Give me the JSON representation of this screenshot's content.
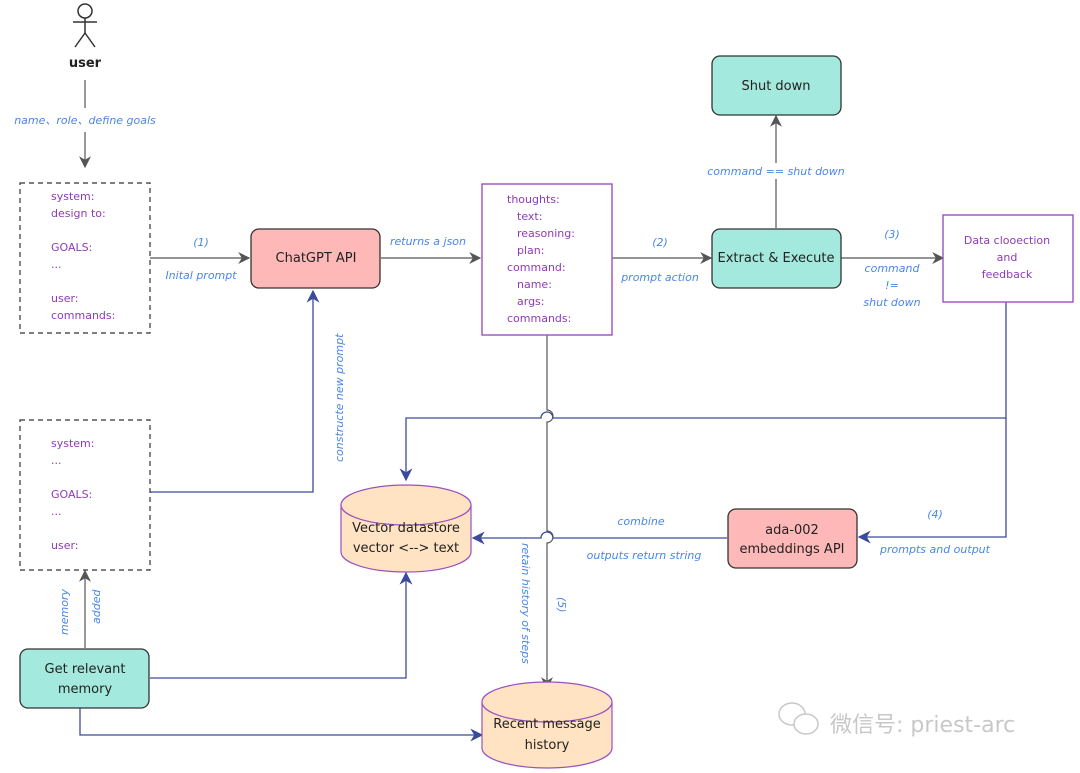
{
  "colors": {
    "teal_node": "#a3e9dd",
    "pink_node": "#ffb8b8",
    "db_fill": "#ffe3c2",
    "db_stroke": "#9b4fc0",
    "purple_box": "#9b4fc0",
    "purple_text": "#8e3bb8",
    "label_blue": "#4a86e8",
    "navy_line": "#3b4a9a",
    "gray_line": "#555555"
  },
  "actor": {
    "label": "user"
  },
  "edges": {
    "user_to_prompt": "name、role、define goals",
    "initial_prompt_step": "(1)",
    "initial_prompt": "Inital prompt",
    "returns_json": "returns a json",
    "prompt_action_step": "(2)",
    "prompt_action": "prompt action",
    "shutdown_condition": "command == shut down",
    "continue_step": "(3)",
    "continue_condition": [
      "command",
      "!=",
      "shut down"
    ],
    "construct_prompt": "constructe new prompt",
    "combine": "combine",
    "outputs_return": "outputs return string",
    "embed_step": "(4)",
    "prompts_and_output": "prompts and output",
    "retain_history": "retain history of steps",
    "history_step": "(5)",
    "memory": "memory",
    "added": "added"
  },
  "nodes": {
    "initial_prompt_box": {
      "lines": [
        "system:",
        "design to:",
        "",
        "GOALS:",
        "...",
        "",
        "user:",
        "commands:"
      ]
    },
    "chatgpt_api": {
      "label": "ChatGPT API"
    },
    "json_response": {
      "lines": [
        "thoughts:",
        "  text:",
        "  reasoning:",
        "  plan:",
        "command:",
        "  name:",
        "  args:",
        "commands:"
      ]
    },
    "shut_down": {
      "label": "Shut down"
    },
    "extract_execute": {
      "label": "Extract & Execute"
    },
    "data_collection": {
      "lines": [
        "Data clooection",
        "and",
        "feedback"
      ]
    },
    "new_prompt_box": {
      "lines": [
        "system:",
        "...",
        "",
        "GOALS:",
        "...",
        "",
        "user:"
      ]
    },
    "vector_datastore": {
      "lines": [
        "Vector datastore",
        "vector <--> text"
      ]
    },
    "embeddings_api": {
      "lines": [
        "ada-002",
        "embeddings API"
      ]
    },
    "get_memory": {
      "lines": [
        "Get relevant",
        "memory"
      ]
    },
    "message_history": {
      "lines": [
        "Recent message",
        "history"
      ]
    }
  },
  "watermark": {
    "text": "微信号: priest-arc"
  }
}
